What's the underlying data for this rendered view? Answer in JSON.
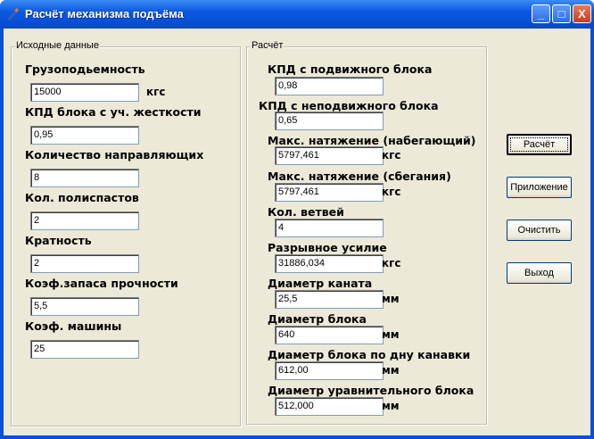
{
  "window": {
    "title": "Расчёт механизма подъёма",
    "minimize": "_",
    "maximize": "□",
    "close": "X"
  },
  "input_group": {
    "label": "Исходные данные",
    "fields": [
      {
        "label": "Грузоподьемность",
        "value": "15000",
        "unit": "кгс"
      },
      {
        "label": "КПД блока с уч. жесткости",
        "value": "0,95"
      },
      {
        "label": "Количество направляющих",
        "value": "8"
      },
      {
        "label": "Кол. полиспастов",
        "value": "2"
      },
      {
        "label": "Кратность",
        "value": "2"
      },
      {
        "label": "Коэф.запаса прочности",
        "value": "5,5"
      },
      {
        "label": "Коэф. машины",
        "value": "25"
      }
    ]
  },
  "result_group": {
    "label": "Расчёт",
    "fields": [
      {
        "label": "КПД с подвижного блока",
        "value": "0,98"
      },
      {
        "label": "КПД с неподвижного блока",
        "value": "0,65"
      },
      {
        "label": "Макс. натяжение (набегающий)",
        "value": "5797,461",
        "unit": "кгс"
      },
      {
        "label": "Макс. натяжение (сбегания)",
        "value": "5797,461",
        "unit": "кгс"
      },
      {
        "label": "Кол. ветвей",
        "value": "4"
      },
      {
        "label": "Разрывное усилие",
        "value": "31886,034",
        "unit": "кгс"
      },
      {
        "label": "Диаметр каната",
        "value": "25,5",
        "unit": "мм"
      },
      {
        "label": "Диаметр блока",
        "value": "640",
        "unit": "мм"
      },
      {
        "label": "Диаметр блока по дну канавки",
        "value": "612,00",
        "unit": "мм"
      },
      {
        "label": "Диаметр уравнительного блока",
        "value": "512,000",
        "unit": "мм"
      }
    ]
  },
  "buttons": {
    "calculate": "Расчёт",
    "appendix": "Приложение",
    "clear": "Очистить",
    "exit": "Выход"
  }
}
